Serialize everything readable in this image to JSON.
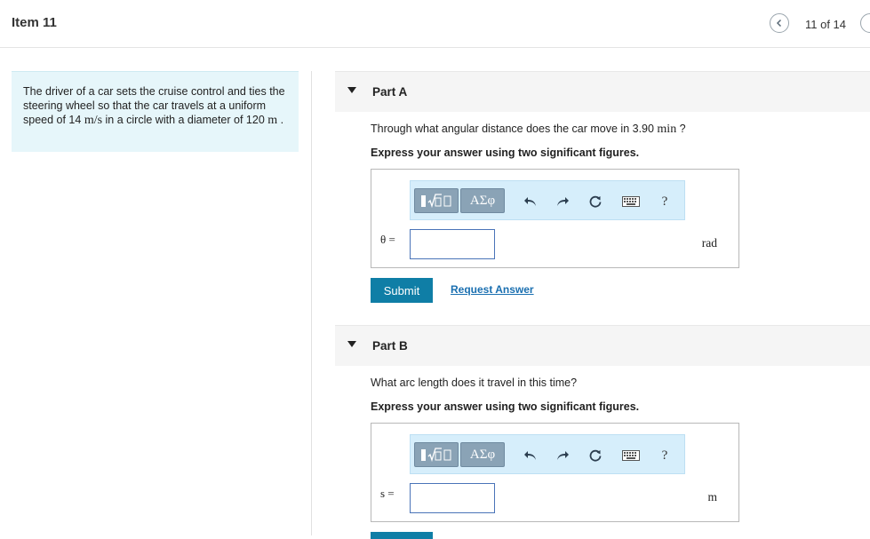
{
  "header": {
    "item_title": "Item 11",
    "counter": "11 of 14"
  },
  "problem": {
    "text_1": "The driver of a car sets the cruise control and ties the steering wheel so that the car travels at a uniform speed of 14 ",
    "speed_unit": "m/s",
    "text_2": " in a circle with a diameter of 120 ",
    "diameter_unit": "m",
    "text_3": " ."
  },
  "parts": [
    {
      "title": "Part A",
      "question_1": "Through what angular distance does the car move in 3.90 ",
      "question_unit": "min",
      "question_2": " ?",
      "instruction": "Express your answer using two significant figures.",
      "variable": "θ =",
      "unit": "rad",
      "input_value": "",
      "submit_label": "Submit",
      "request_label": "Request Answer"
    },
    {
      "title": "Part B",
      "question_1": "What arc length does it travel in this time?",
      "instruction": "Express your answer using two significant figures.",
      "variable": "s =",
      "unit": "m",
      "input_value": ""
    }
  ],
  "toolbar": {
    "greek_label": "ΑΣφ",
    "help_label": "?",
    "icons": [
      "template-icon",
      "undo-icon",
      "redo-icon",
      "reset-icon",
      "keyboard-icon",
      "help-icon"
    ]
  },
  "colors": {
    "accent": "#0f7ea6",
    "problem_bg": "#e6f6fa",
    "toolbar_bg": "#d6eefb",
    "link": "#1a6fb0"
  }
}
